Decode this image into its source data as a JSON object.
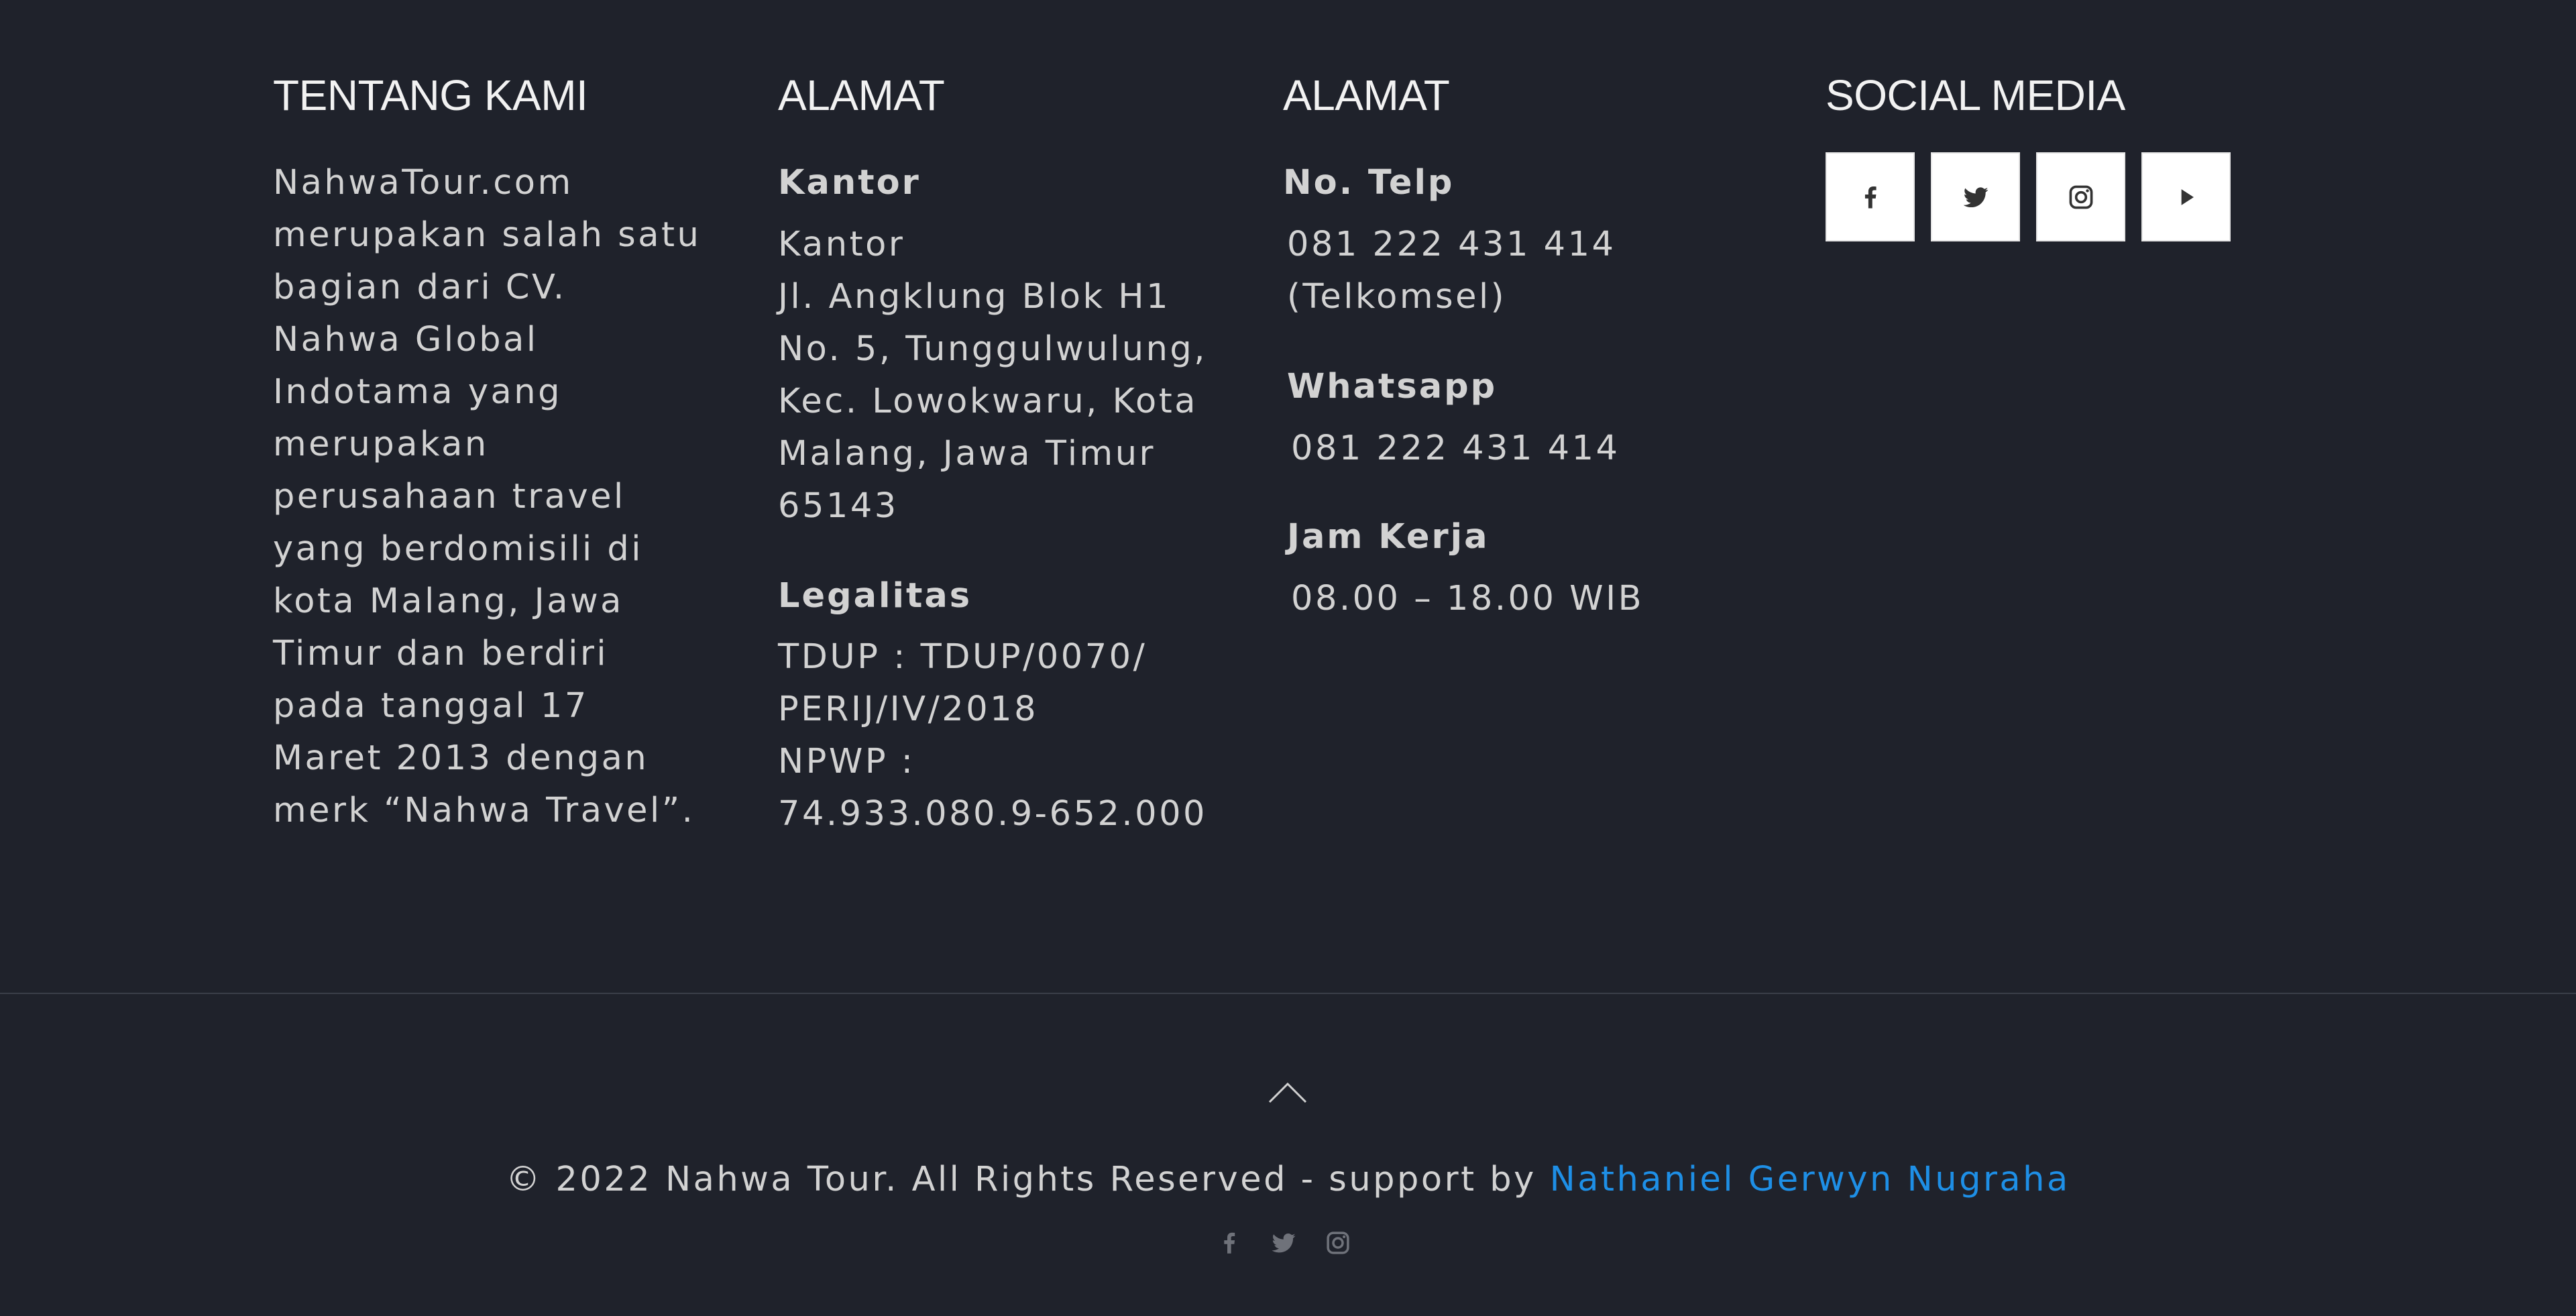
{
  "about": {
    "title": "TENTANG KAMI",
    "text_lines": [
      "NahwaTour.com",
      "merupakan salah satu",
      "bagian dari CV.",
      "Nahwa Global",
      "Indotama yang",
      "merupakan",
      "perusahaan travel",
      "yang berdomisili di",
      "kota Malang, Jawa",
      "Timur dan berdiri",
      "pada tanggal 17",
      "Maret 2013 dengan",
      "merk “Nahwa Travel”."
    ]
  },
  "address": {
    "title": "ALAMAT",
    "office_heading": "Kantor",
    "office_lines": [
      "Kantor",
      "Jl. Angklung Blok H1",
      "No. 5, Tunggulwulung,",
      "Kec. Lowokwaru, Kota",
      "Malang, Jawa Timur",
      "65143"
    ],
    "legal_heading": "Legalitas",
    "legal_lines": [
      "TDUP : TDUP/0070/",
      "PERIJ/IV/2018",
      "NPWP :",
      "74.933.080.9-652.000"
    ]
  },
  "contact": {
    "title": "ALAMAT",
    "phone_heading": "No. Telp",
    "phone_lines": [
      "081 222 431 414",
      "(Telkomsel)"
    ],
    "whatsapp_heading": "Whatsapp",
    "whatsapp_value": "081 222 431 414",
    "hours_heading": "Jam Kerja",
    "hours_value": "08.00 – 18.00 WIB"
  },
  "social": {
    "title": "SOCIAL MEDIA",
    "buttons": [
      "facebook-icon",
      "twitter-icon",
      "instagram-icon",
      "youtube-icon"
    ]
  },
  "footer": {
    "copyright_prefix": "© 2022 Nahwa Tour. All Rights Reserved - support by ",
    "author_link": "Nathaniel Gerwyn Nugraha",
    "link_color": "#1e8fe6",
    "icons": [
      "facebook-icon",
      "twitter-icon",
      "instagram-icon"
    ]
  },
  "colors": {
    "background": "#1f222b",
    "text": "#d2d2d2",
    "icon_dark": "#333333",
    "icon_muted": "#6f727a"
  }
}
